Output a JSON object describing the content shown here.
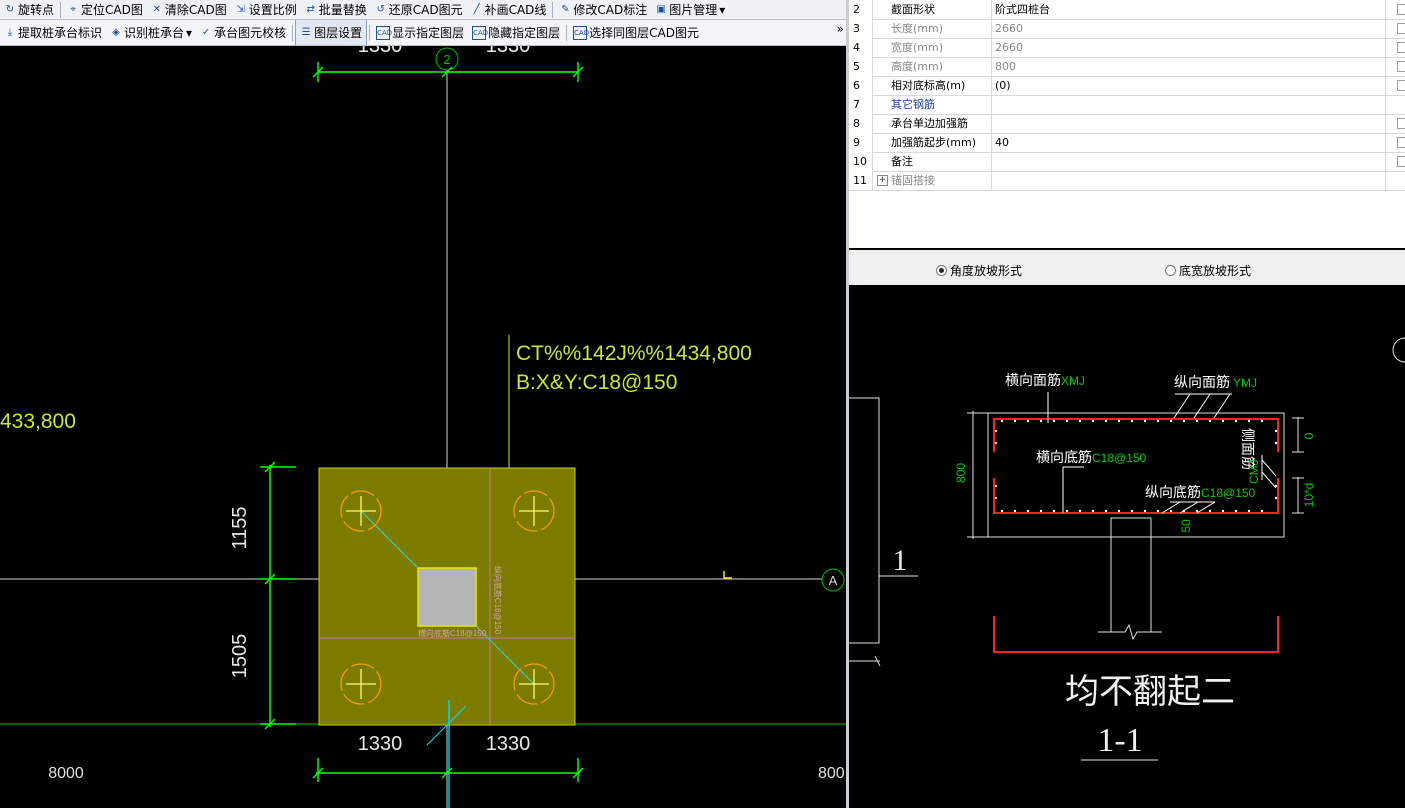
{
  "toolbar1": {
    "items": [
      "旋转点",
      "定位CAD图",
      "清除CAD图",
      "设置比例",
      "批量替换",
      "还原CAD图元",
      "补画CAD线",
      "修改CAD标注",
      "图片管理"
    ]
  },
  "toolbar2": {
    "items": [
      "提取桩承台标识",
      "识别桩承台",
      "承台图元校核",
      "图层设置",
      "显示指定图层",
      "隐藏指定图层",
      "选择同图层CAD图元"
    ],
    "more": "»"
  },
  "properties": {
    "rows": [
      {
        "num": "2",
        "name": "截面形状",
        "value": "阶式四桩台",
        "style": "",
        "check": true
      },
      {
        "num": "3",
        "name": "长度(mm)",
        "value": "2660",
        "style": "gray",
        "check": true
      },
      {
        "num": "4",
        "name": "宽度(mm)",
        "value": "2660",
        "style": "gray",
        "check": true
      },
      {
        "num": "5",
        "name": "高度(mm)",
        "value": "800",
        "style": "gray",
        "check": true
      },
      {
        "num": "6",
        "name": "相对底标高(m)",
        "value": "(0)",
        "style": "",
        "check": true
      },
      {
        "num": "7",
        "name": "其它钢筋",
        "value": "",
        "style": "blue",
        "check": false
      },
      {
        "num": "8",
        "name": "承台单边加强筋",
        "value": "",
        "style": "",
        "check": true
      },
      {
        "num": "9",
        "name": "加强筋起步(mm)",
        "value": "40",
        "style": "",
        "check": true
      },
      {
        "num": "10",
        "name": "备注",
        "value": "",
        "style": "",
        "check": true
      },
      {
        "num": "11",
        "name": "锚固搭接",
        "value": "",
        "style": "gray",
        "check": false,
        "expander": "+"
      }
    ]
  },
  "slope_options": {
    "angle_label": "角度放坡形式",
    "width_label": "底宽放坡形式",
    "selected": "angle"
  },
  "cad": {
    "axis_top": "2",
    "axis_right": "A",
    "dim_top_left": "1330",
    "dim_top_right": "1330",
    "dim_left_upper": "1155",
    "dim_left_lower": "1505",
    "dim_bottom_left": "1330",
    "dim_bottom_right": "1330",
    "label_line1": "CT%%142J%%1434,800",
    "label_line2": "B:X&Y:C18@150",
    "left_label": "433,800",
    "bottom_left_num": "8000",
    "bottom_right_num": "800",
    "inner_text_h": "横向底筋C18@150",
    "inner_text_v": "纵向底筋C18@150",
    "section_mark": "1",
    "colors": {
      "pile_cap": "#7b7b00",
      "dim": "#00ff00",
      "label": "#c8e632",
      "pile": "#ffaa00"
    }
  },
  "section": {
    "top_bar_h_label": "横向面筋",
    "top_bar_h_code": "XMJ",
    "top_bar_v_label": "纵向面筋",
    "top_bar_v_code": "YMJ",
    "bottom_bar_h_label": "横向底筋",
    "bottom_bar_h_code": "C18@150",
    "bottom_bar_v_label": "纵向底筋",
    "bottom_bar_v_code": "C18@150",
    "side_bar_label": "侧面筋",
    "side_bar_code": "CMJ",
    "height": "800",
    "dim_0": "0",
    "dim_10d": "10*d",
    "dim_50": "50",
    "caption": "均不翻起二",
    "section_title": "1-1"
  }
}
